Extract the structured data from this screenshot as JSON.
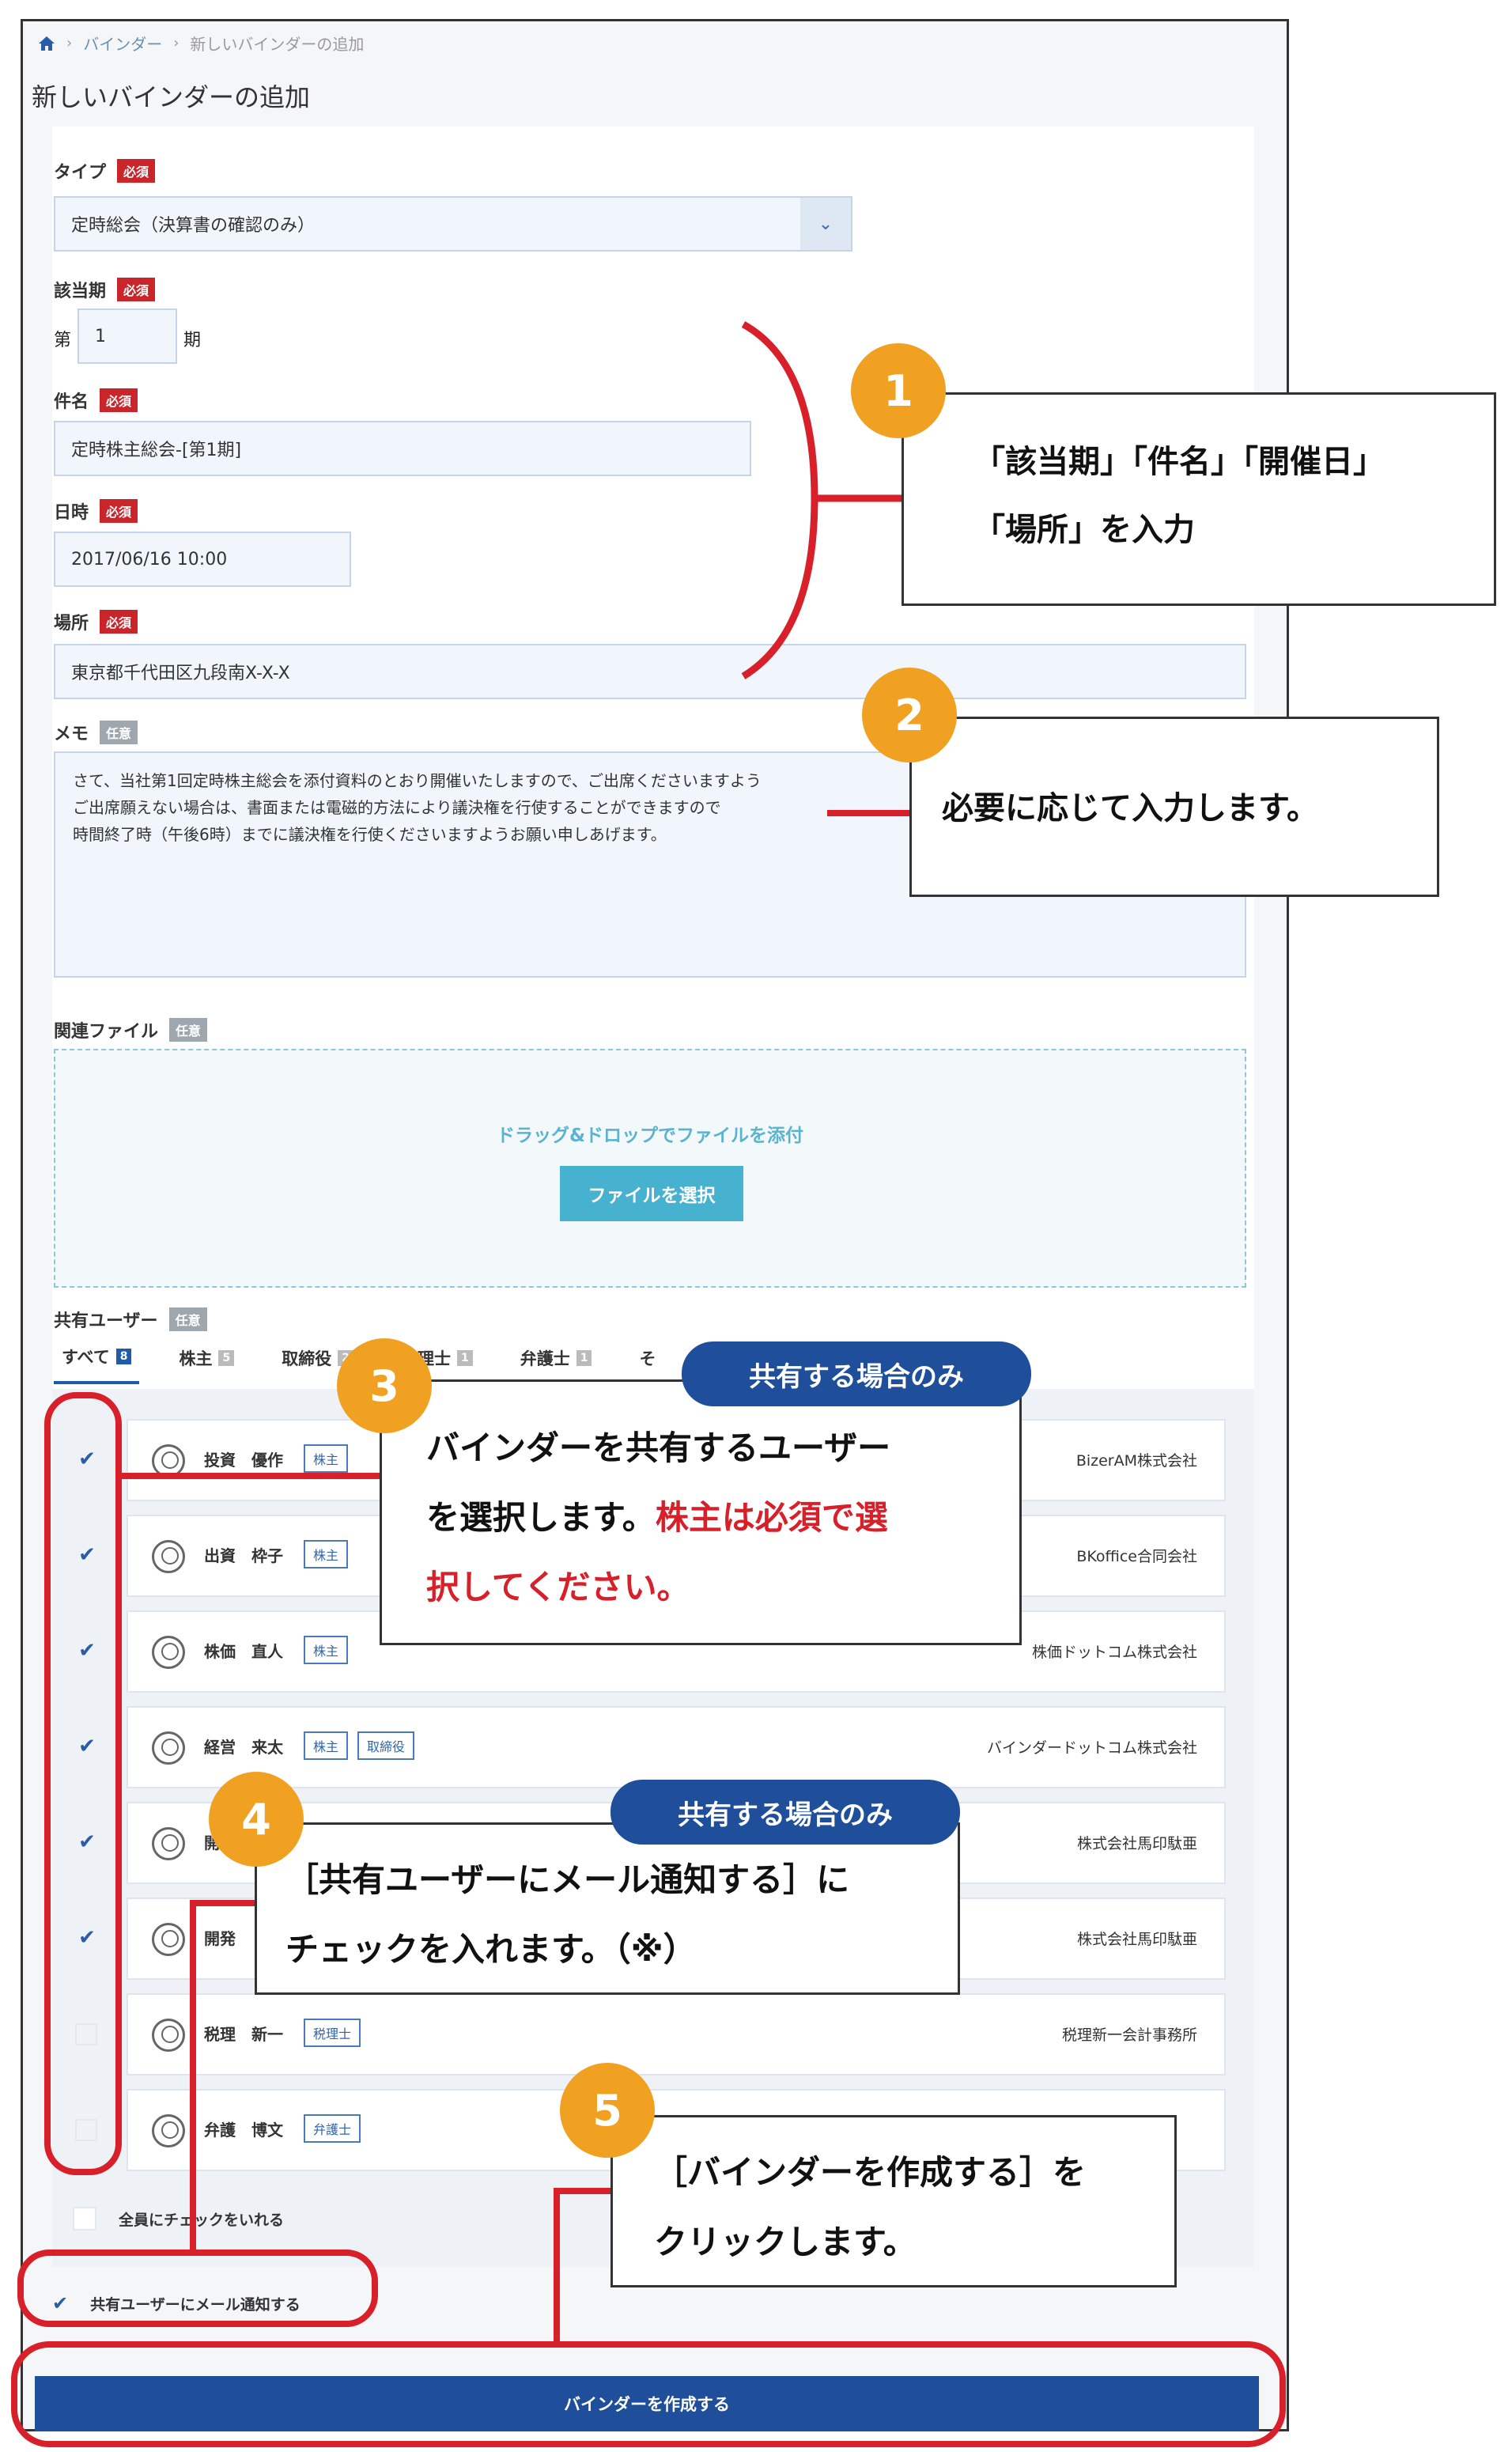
{
  "breadcrumb": {
    "level1": "バインダー",
    "current": "新しいバインダーの追加"
  },
  "page_title": "新しいバインダーの追加",
  "form": {
    "type_label": "タイプ",
    "required_badge": "必須",
    "optional_badge": "任意",
    "type_value": "定時総会（決算書の確認のみ）",
    "period_label": "該当期",
    "period_prefix": "第",
    "period_value": "1",
    "period_suffix": "期",
    "subject_label": "件名",
    "subject_value": "定時株主総会-[第1期]",
    "datetime_label": "日時",
    "datetime_value": "2017/06/16 10:00",
    "place_label": "場所",
    "place_value": "東京都千代田区九段南X-X-X",
    "memo_label": "メモ",
    "memo_lines": [
      "さて、当社第1回定時株主総会を添付資料のとおり開催いたしますので、ご出席くださいますよう",
      "ご出席願えない場合は、書面または電磁的方法により議決権を行使することができますので",
      "時間終了時（午後6時）までに議決権を行使くださいますようお願い申しあげます。"
    ],
    "file_label": "関連ファイル",
    "drop_text": "ドラッグ&ドロップでファイルを添付",
    "file_button": "ファイルを選択",
    "share_label": "共有ユーザー"
  },
  "tabs": [
    {
      "label": "すべて",
      "count": "8"
    },
    {
      "label": "株主",
      "count": "5"
    },
    {
      "label": "取締役",
      "count": "2"
    },
    {
      "label": "税理士",
      "count": "1"
    },
    {
      "label": "弁護士",
      "count": "1"
    },
    {
      "label": "そ",
      "count": ""
    }
  ],
  "users": [
    {
      "checked": true,
      "name": "投資　優作",
      "tags": [
        "株主"
      ],
      "company": "BizerAM株式会社"
    },
    {
      "checked": true,
      "name": "出資　枠子",
      "tags": [
        "株主"
      ],
      "company": "BKoffice合同会社"
    },
    {
      "checked": true,
      "name": "株価　直人",
      "tags": [
        "株主"
      ],
      "company": "株価ドットコム株式会社"
    },
    {
      "checked": true,
      "name": "経営　来太",
      "tags": [
        "株主",
        "取締役"
      ],
      "company": "バインダードットコム株式会社"
    },
    {
      "checked": true,
      "name": "開",
      "tags": [],
      "company": "株式会社馬印駄亜"
    },
    {
      "checked": true,
      "name": "開発",
      "tags": [],
      "company": "株式会社馬印駄亜"
    },
    {
      "checked": false,
      "name": "税理　新一",
      "tags": [
        "税理士"
      ],
      "company": "税理新一会計事務所"
    },
    {
      "checked": false,
      "name": "弁護　博文",
      "tags": [
        "弁護士"
      ],
      "company": ""
    }
  ],
  "check_all_label": "全員にチェックをいれる",
  "notify_label": "共有ユーザーにメール通知する",
  "submit_label": "バインダーを作成する",
  "callouts": {
    "c1_num": "1",
    "c1_line1": "「該当期」「件名」「開催日」",
    "c1_line2": "「場所」を入力",
    "c2_num": "2",
    "c2_text": "必要に応じて入力します。",
    "c3_num": "3",
    "c3_pill": "共有する場合のみ",
    "c3_line1": "バインダーを共有するユーザー",
    "c3_line2a": "を選択します。",
    "c3_line2b": "株主は必須で選",
    "c3_line3": "択してください。",
    "c4_num": "4",
    "c4_pill": "共有する場合のみ",
    "c4_line1": "［共有ユーザーにメール通知する］に",
    "c4_line2": "チェックを入れます。（※）",
    "c5_num": "5",
    "c5_line1": "［バインダーを作成する］を",
    "c5_line2": "クリックします。"
  },
  "colors": {
    "accent": "#1f4f9b",
    "required": "#c9252b",
    "callout_circle": "#f0a122",
    "highlight": "#d8202a"
  }
}
